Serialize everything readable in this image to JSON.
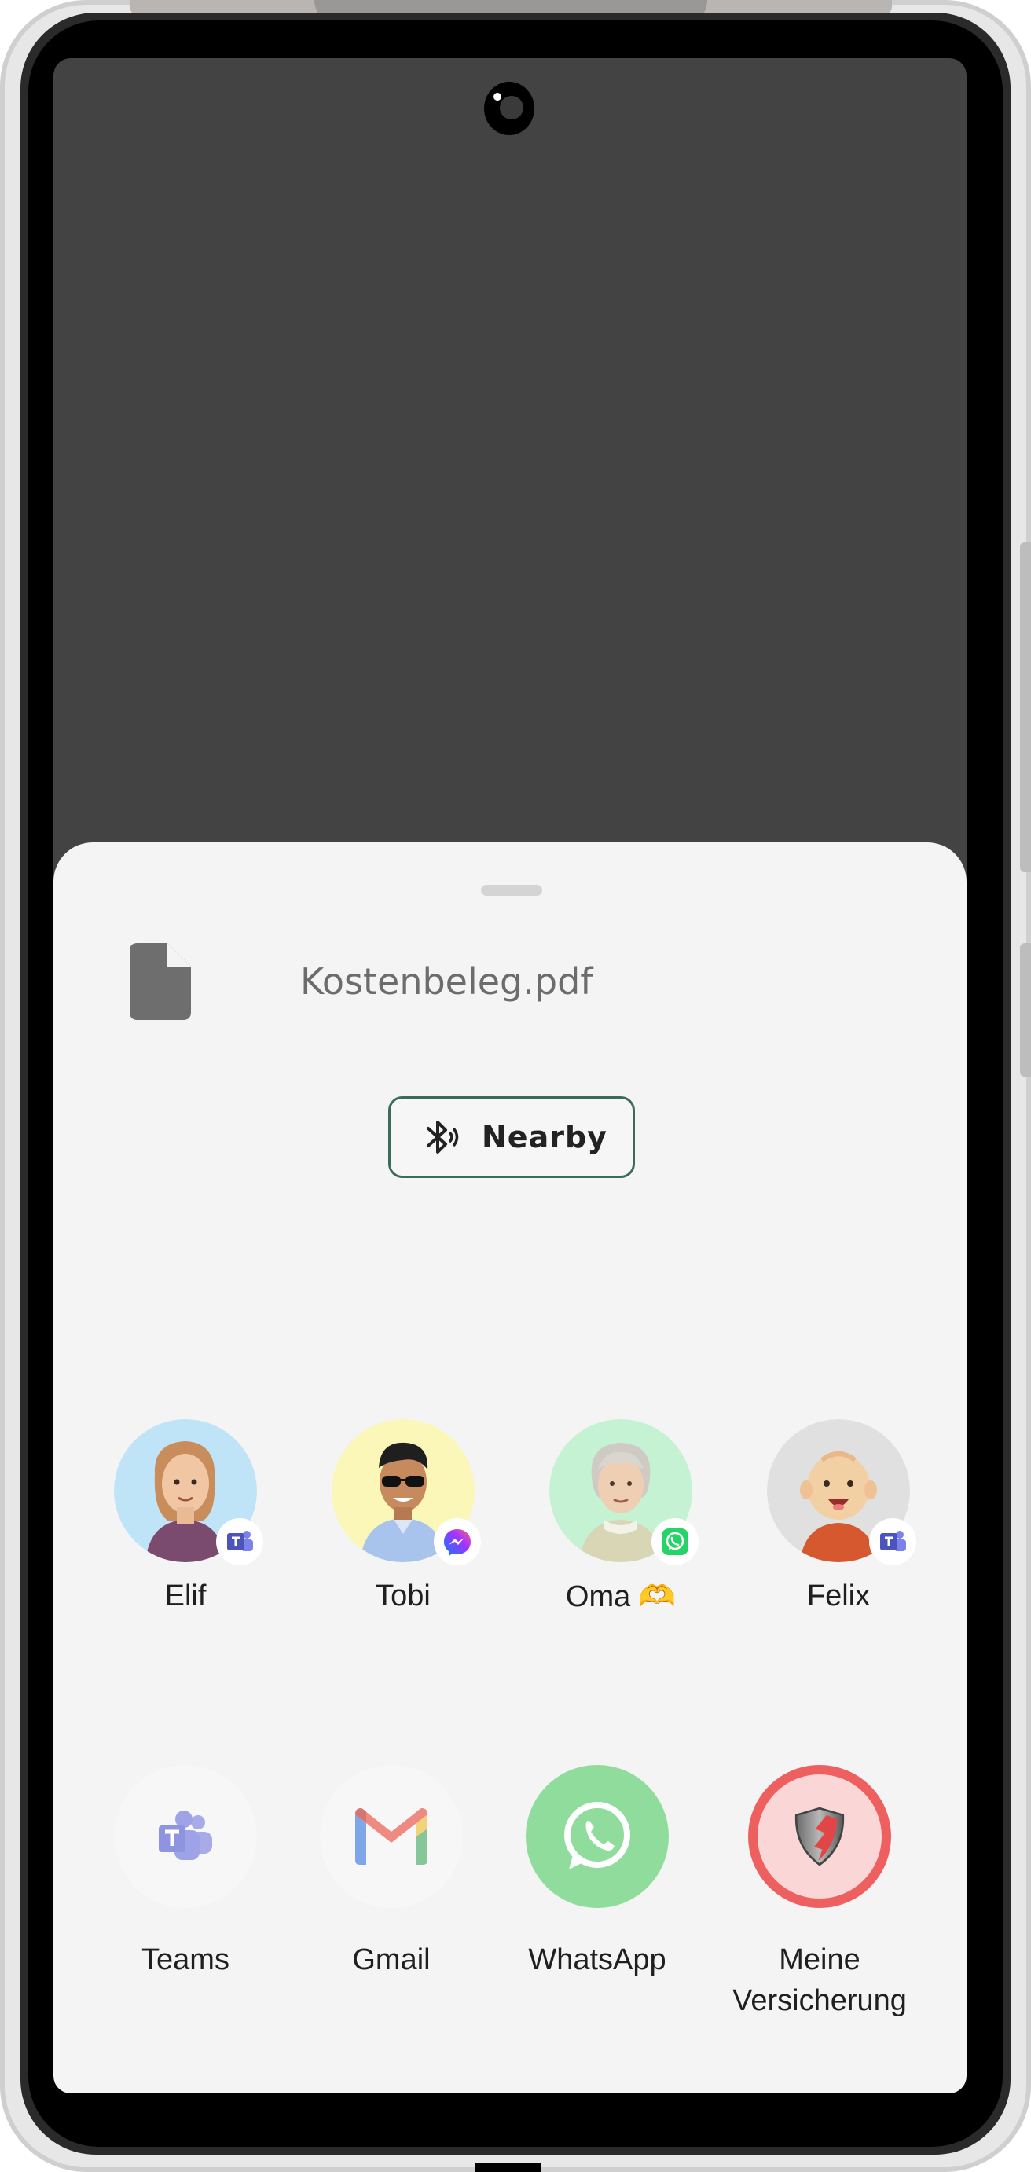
{
  "share_sheet": {
    "file_name": "Kostenbeleg.pdf",
    "nearby_label": "Nearby"
  },
  "contacts": [
    {
      "name": "Elif",
      "app_badge": "teams-icon",
      "avatar_bg": "#bfe3f7"
    },
    {
      "name": "Tobi",
      "app_badge": "messenger-icon",
      "avatar_bg": "#fbf7b8"
    },
    {
      "name": "Oma 🫶",
      "app_badge": "whatsapp-icon",
      "avatar_bg": "#c5f2d3"
    },
    {
      "name": "Felix",
      "app_badge": "teams-icon",
      "avatar_bg": "#e0e0e0"
    }
  ],
  "apps": [
    {
      "name": "Teams",
      "icon": "teams-icon"
    },
    {
      "name": "Gmail",
      "icon": "gmail-icon"
    },
    {
      "name": "WhatsApp",
      "icon": "whatsapp-icon"
    },
    {
      "name": "Meine Versicherung",
      "icon": "shield-icon"
    }
  ],
  "colors": {
    "sheet_bg": "#f4f4f4",
    "screen_bg": "#434343",
    "nearby_border": "#3b6b5f",
    "whatsapp_green": "#8fdc9c",
    "insurance_ring": "#ee5f5f",
    "teams_purple": "#5b5fc7"
  }
}
